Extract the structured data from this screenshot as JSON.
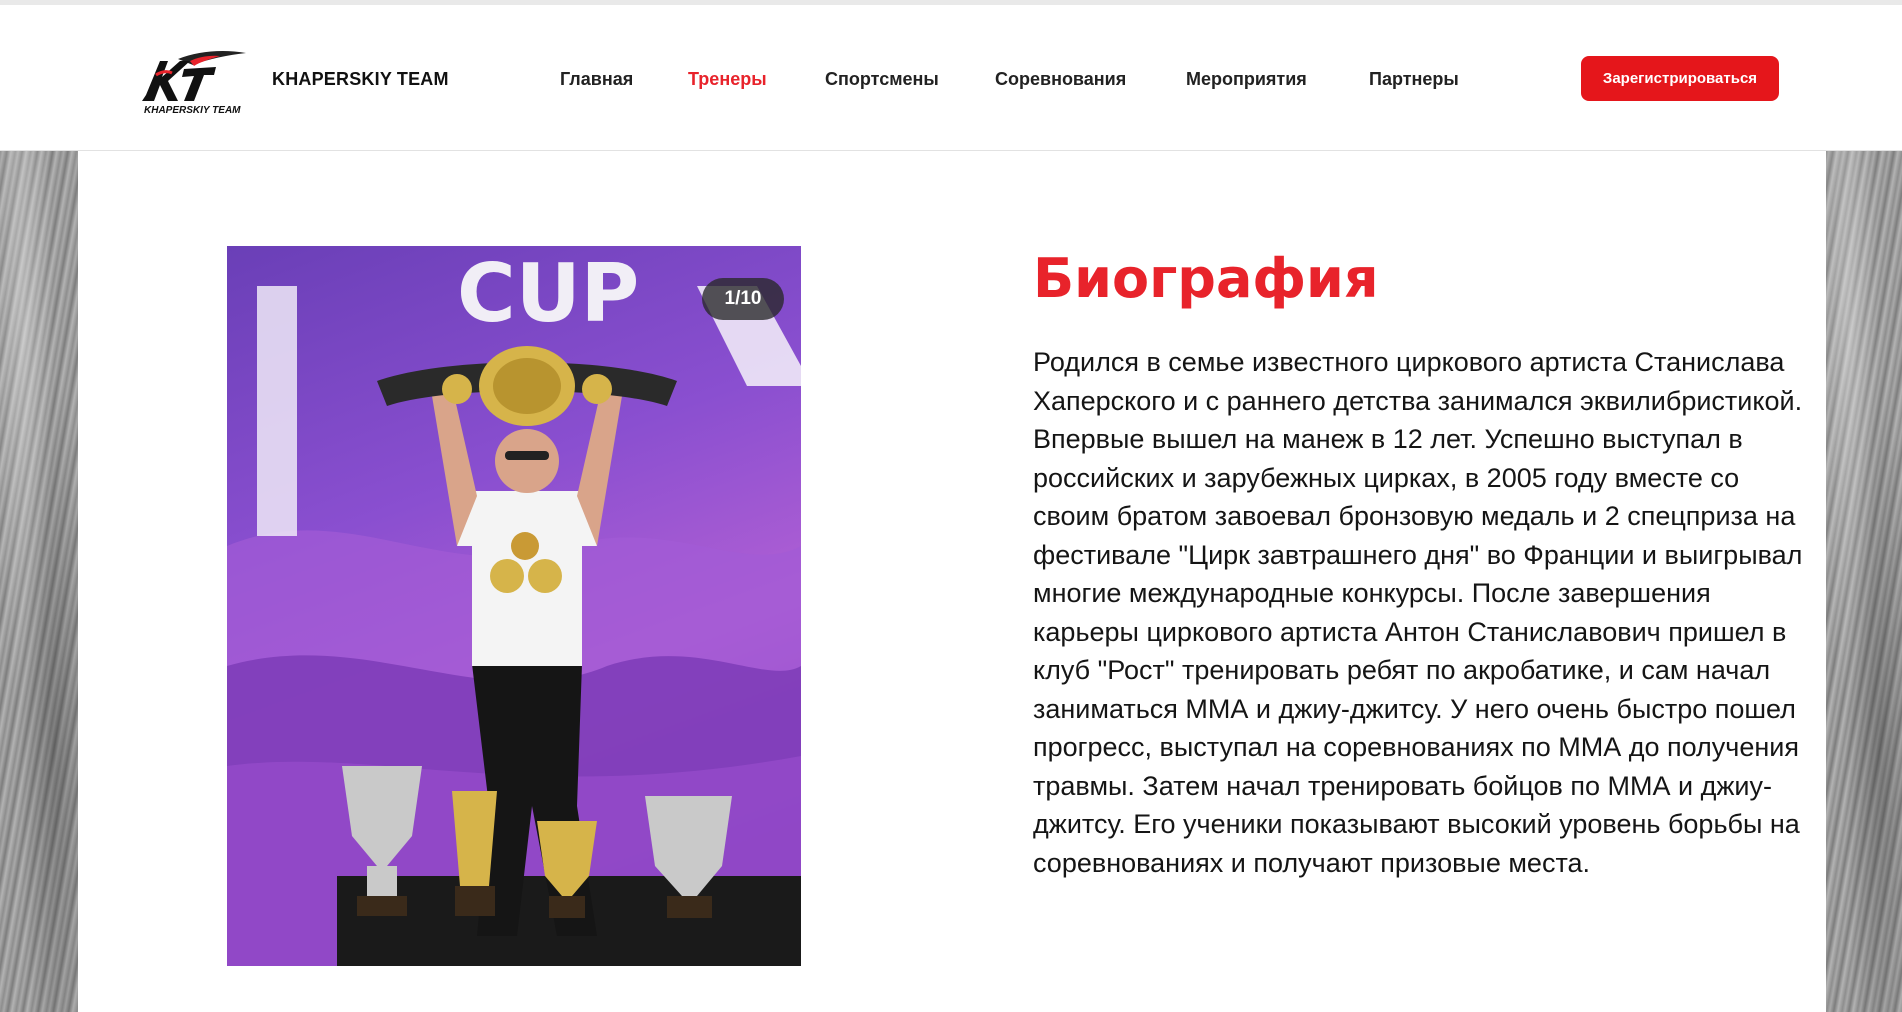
{
  "header": {
    "logo_text": "KHAPERSKIY TEAM",
    "brand": "KHAPERSKIY TEAM",
    "nav": [
      {
        "label": "Главная"
      },
      {
        "label": "Тренеры",
        "active": true
      },
      {
        "label": "Спортсмены"
      },
      {
        "label": "Соревнования"
      },
      {
        "label": "Мероприятия"
      },
      {
        "label": "Партнеры"
      }
    ],
    "register_label": "Зарегистрироваться"
  },
  "gallery": {
    "counter": "1/10",
    "backdrop_text": "CUP"
  },
  "biography": {
    "title": "Биография",
    "text": "Родился в семье известного циркового артиста Станислава Хаперского и с раннего детства занимался эквилибристикой. Впервые вышел на манеж в 12 лет. Успешно выступал в российских и зарубежных цирках, в 2005 году вместе со своим братом завоевал бронзовую медаль и 2 спецприза на фестивале \"Цирк завтрашнего дня\" во Франции и выигрывал многие международные конкурсы. После завершения карьеры циркового артиста Антон Станиславович пришел в клуб \"Рост\" тренировать ребят по акробатике, и сам начал заниматься ММА и джиу-джитсу. У него очень быстро пошел прогресс, выступал на соревнованиях по ММА до получения травмы. Затем начал тренировать бойцов по ММА и джиу-джитсу. Его ученики показывают высокий уровень борьбы на соревнованиях и получают призовые места."
  },
  "colors": {
    "accent": "#e8232b",
    "button": "#e5161b"
  }
}
